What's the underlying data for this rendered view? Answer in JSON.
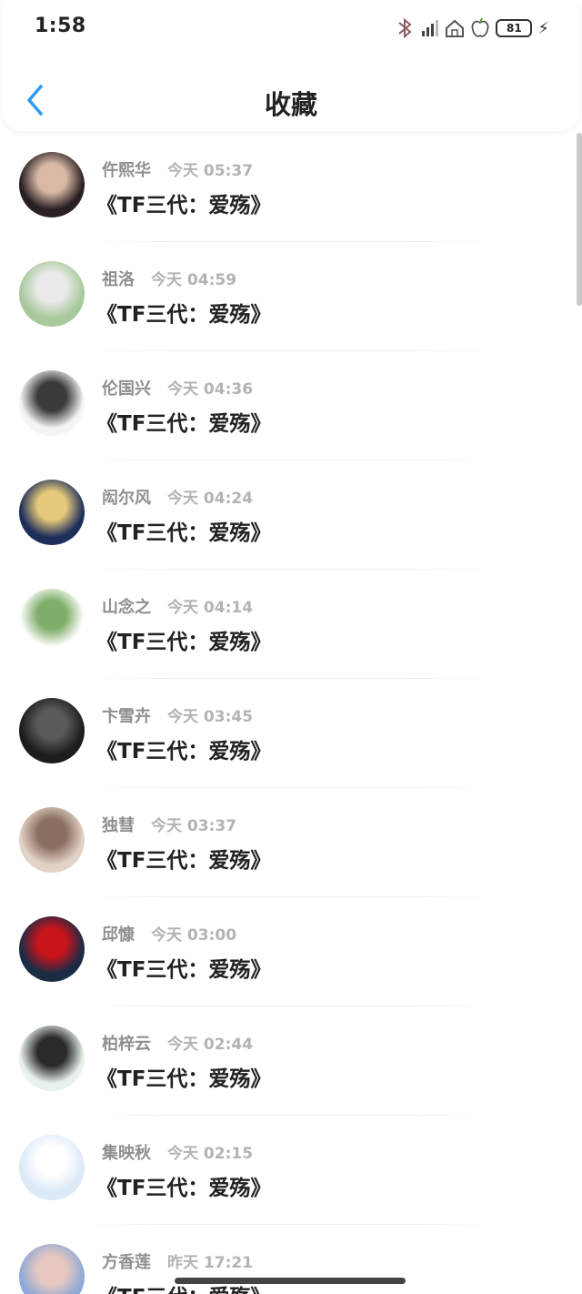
{
  "status_bar": {
    "time": "1:58",
    "battery": "81",
    "icons": [
      "bluetooth-icon",
      "signal-icon",
      "home-icon",
      "apple-icon",
      "battery-icon",
      "charging-icon"
    ]
  },
  "header": {
    "title": "收藏",
    "back_icon": "chevron-left-icon",
    "accent_color": "#2b9af3"
  },
  "list": {
    "items": [
      {
        "name": "仵熙华",
        "stamp": "今天 05:37",
        "post": "《TF三代：爱殇》",
        "avatar_colors": [
          "#2a1f24",
          "#d9b9a6"
        ]
      },
      {
        "name": "祖洛",
        "stamp": "今天 04:59",
        "post": "《TF三代：爱殇》",
        "avatar_colors": [
          "#a8c99b",
          "#eaeaea"
        ]
      },
      {
        "name": "伦国兴",
        "stamp": "今天 04:36",
        "post": "《TF三代：爱殇》",
        "avatar_colors": [
          "#f4f4f4",
          "#3a3a3a"
        ]
      },
      {
        "name": "闳尔风",
        "stamp": "今天 04:24",
        "post": "《TF三代：爱殇》",
        "avatar_colors": [
          "#1d2e5a",
          "#e6c97a"
        ]
      },
      {
        "name": "山念之",
        "stamp": "今天 04:14",
        "post": "《TF三代：爱殇》",
        "avatar_colors": [
          "#ffffff",
          "#7fae6a"
        ]
      },
      {
        "name": "卞雪卉",
        "stamp": "今天 03:45",
        "post": "《TF三代：爱殇》",
        "avatar_colors": [
          "#1c1c1c",
          "#5a5a5a"
        ]
      },
      {
        "name": "独彗",
        "stamp": "今天 03:37",
        "post": "《TF三代：爱殇》",
        "avatar_colors": [
          "#e3d2c6",
          "#8a6f60"
        ]
      },
      {
        "name": "邱慷",
        "stamp": "今天 03:00",
        "post": "《TF三代：爱殇》",
        "avatar_colors": [
          "#1a2b44",
          "#c8141b"
        ]
      },
      {
        "name": "柏梓云",
        "stamp": "今天 02:44",
        "post": "《TF三代：爱殇》",
        "avatar_colors": [
          "#e8f1ea",
          "#2a2a2a"
        ]
      },
      {
        "name": "集映秋",
        "stamp": "今天 02:15",
        "post": "《TF三代：爱殇》",
        "avatar_colors": [
          "#dce9f7",
          "#ffffff"
        ]
      },
      {
        "name": "方香莲",
        "stamp": "昨天 17:21",
        "post": "《TF三代：爱殇》",
        "avatar_colors": [
          "#8fa9d6",
          "#e7c8c0"
        ]
      }
    ]
  }
}
